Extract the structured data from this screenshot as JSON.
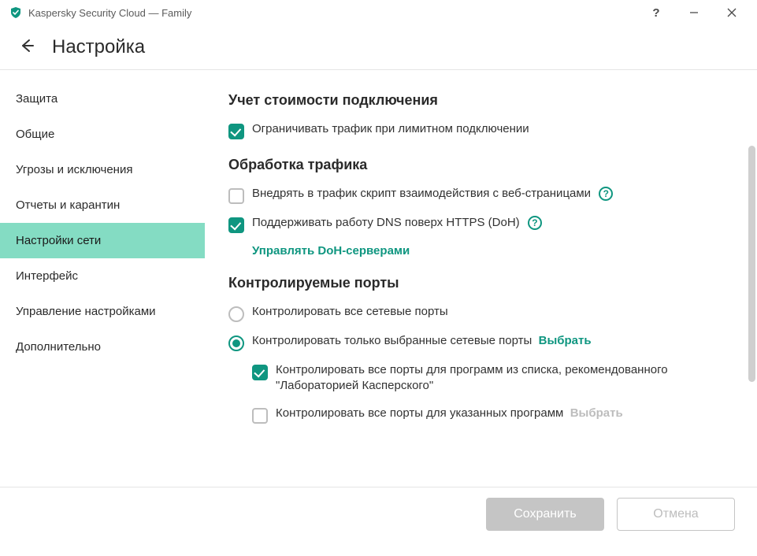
{
  "app": {
    "title": "Kaspersky Security Cloud — Family"
  },
  "header": {
    "page_title": "Настройка"
  },
  "sidebar": {
    "items": [
      {
        "label": "Защита"
      },
      {
        "label": "Общие"
      },
      {
        "label": "Угрозы и исключения"
      },
      {
        "label": "Отчеты и карантин"
      },
      {
        "label": "Настройки сети"
      },
      {
        "label": "Интерфейс"
      },
      {
        "label": "Управление настройками"
      },
      {
        "label": "Дополнительно"
      }
    ],
    "active_index": 4
  },
  "sections": {
    "metering": {
      "title": "Учет стоимости подключения",
      "limit_traffic": {
        "checked": true,
        "label": "Ограничивать трафик при лимитном подключении"
      }
    },
    "traffic": {
      "title": "Обработка трафика",
      "inject_script": {
        "checked": false,
        "label": "Внедрять в трафик скрипт взаимодействия с веб-страницами"
      },
      "dns_doh": {
        "checked": true,
        "label": "Поддерживать работу DNS поверх HTTPS (DoH)"
      },
      "manage_doh_link": "Управлять DoH-серверами"
    },
    "ports": {
      "title": "Контролируемые порты",
      "all_ports": {
        "selected": false,
        "label": "Контролировать все сетевые порты"
      },
      "selected_ports": {
        "selected": true,
        "label": "Контролировать только выбранные сетевые порты"
      },
      "select_link": "Выбрать",
      "kaspersky_list": {
        "checked": true,
        "label": "Контролировать все порты для программ из списка, рекомендованного \"Лабораторией Касперского\""
      },
      "specified_programs": {
        "checked": false,
        "label": "Контролировать все порты для указанных программ"
      },
      "select_link2": "Выбрать"
    }
  },
  "footer": {
    "save": "Сохранить",
    "cancel": "Отмена"
  },
  "colors": {
    "accent": "#0f9680",
    "sidebar_active": "#84dcc3"
  }
}
